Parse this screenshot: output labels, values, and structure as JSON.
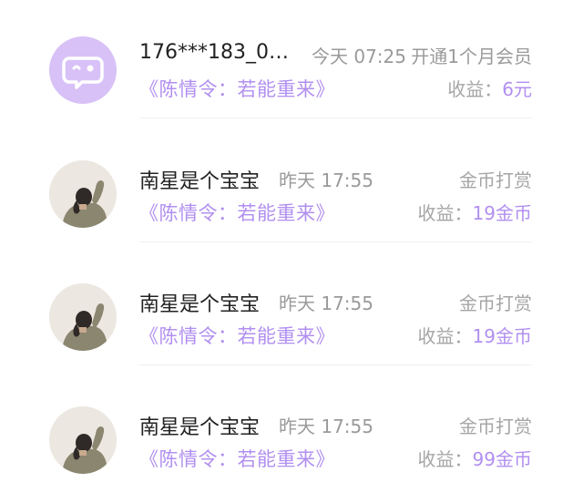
{
  "records": [
    {
      "avatar": "default-avatar-icon",
      "name": "176***183_0…",
      "time": "今天  07:25",
      "action": "开通1个月会员",
      "book": "《陈情令：若能重来》",
      "income_label": "收益：",
      "income_value": "6元"
    },
    {
      "avatar": "user-photo-avatar",
      "name": "南星是个宝宝",
      "time": "昨天  17:55",
      "action": "金币打赏",
      "book": "《陈情令：若能重来》",
      "income_label": "收益：",
      "income_value": "19金币"
    },
    {
      "avatar": "user-photo-avatar",
      "name": "南星是个宝宝",
      "time": "昨天  17:55",
      "action": "金币打赏",
      "book": "《陈情令：若能重来》",
      "income_label": "收益：",
      "income_value": "19金币"
    },
    {
      "avatar": "user-photo-avatar",
      "name": "南星是个宝宝",
      "time": "昨天  17:55",
      "action": "金币打赏",
      "book": "《陈情令：若能重来》",
      "income_label": "收益：",
      "income_value": "99金币"
    }
  ],
  "colors": {
    "accent_purple": "#b18ff0",
    "default_avatar_bg": "#d8c1f7",
    "muted_text": "#9a9a9a",
    "primary_text": "#222222"
  }
}
